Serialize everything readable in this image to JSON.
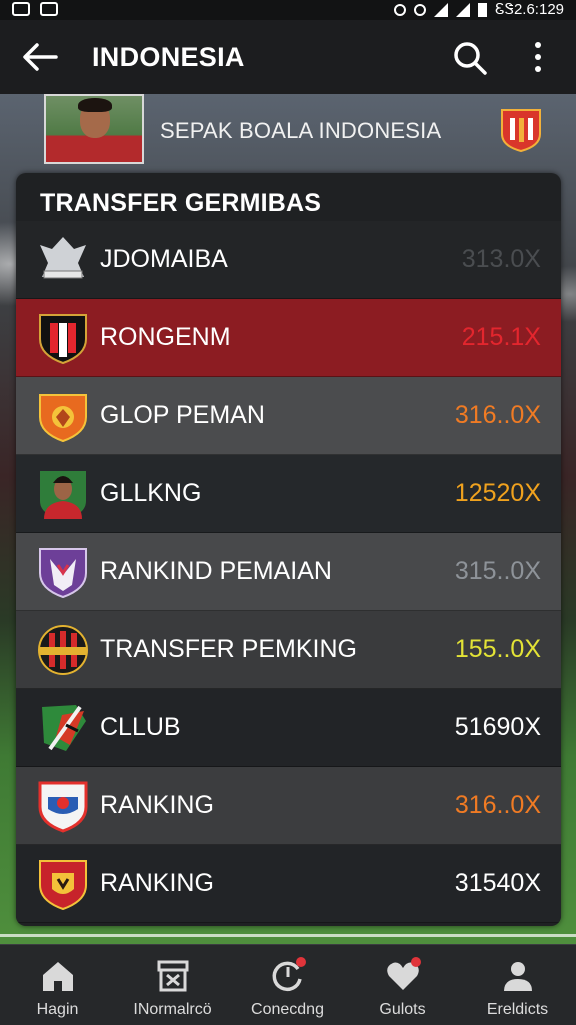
{
  "status_bar": {
    "time": "ᏋᏕ2.6:129"
  },
  "app_bar": {
    "title": "INDONESIA",
    "back_icon": "arrow-left-icon",
    "search_icon": "search-icon",
    "more_icon": "more-vertical-icon"
  },
  "banner": {
    "title": "SEPAK BOALA INDONESIA"
  },
  "panel": {
    "title": "TRANSFER GERMIBAS",
    "rows": [
      {
        "name": "JDOMAIBA",
        "value": "313.0X",
        "value_color": "#4a4d50",
        "bg": "#232527",
        "crest": "eagle-crest-icon"
      },
      {
        "name": "RONGENM",
        "value": "215.1X",
        "value_color": "#e3262e",
        "bg": "#8c1c22",
        "crest": "red-black-shield-icon"
      },
      {
        "name": "GLOP PEMAN",
        "value": "316..0X",
        "value_color": "#f07b24",
        "bg": "#4b4c4e",
        "crest": "orange-lion-crest-icon"
      },
      {
        "name": "GLLKNG",
        "value": "12520X",
        "value_color": "#f0a21e",
        "bg": "#25282b",
        "crest": "player-avatar-icon"
      },
      {
        "name": "RANKIND PEMAIAN",
        "value": "315..0X",
        "value_color": "#8e9399",
        "bg": "#48494b",
        "crest": "purple-crest-icon"
      },
      {
        "name": "TRANSFER PEMKING",
        "value": "155..0X",
        "value_color": "#e3e336",
        "bg": "#3a3b3d",
        "crest": "striped-crest-icon"
      },
      {
        "name": "CLLUB",
        "value": "51690X",
        "value_color": "#ffffff",
        "bg": "#222427",
        "crest": "green-red-crest-icon"
      },
      {
        "name": "RANKING",
        "value": "316..0X",
        "value_color": "#f07b24",
        "bg": "#3c3d3f",
        "crest": "blue-red-crest-icon"
      },
      {
        "name": "RANKING",
        "value": "31540X",
        "value_color": "#ffffff",
        "bg": "#222427",
        "crest": "red-tiger-crest-icon"
      }
    ]
  },
  "bottom_nav": [
    {
      "label": "Hagin",
      "icon": "home-icon",
      "badge": false
    },
    {
      "label": "INormalrcö",
      "icon": "archive-icon",
      "badge": false
    },
    {
      "label": "Conecdng",
      "icon": "refresh-icon",
      "badge": true
    },
    {
      "label": "Gulots",
      "icon": "heart-icon",
      "badge": true
    },
    {
      "label": "Ereldicts",
      "icon": "profile-icon",
      "badge": false
    }
  ]
}
